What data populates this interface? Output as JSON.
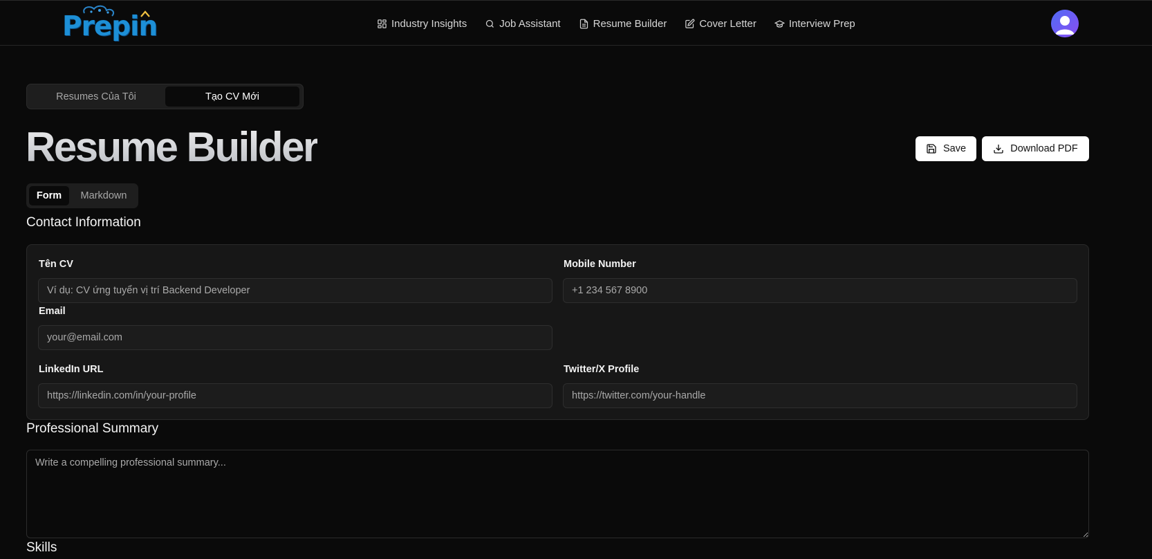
{
  "header": {
    "logo_text": "Prepin",
    "nav": [
      {
        "label": "Industry Insights",
        "icon": "dashboard-icon"
      },
      {
        "label": "Job Assistant",
        "icon": "search-icon"
      },
      {
        "label": "Resume Builder",
        "icon": "document-icon"
      },
      {
        "label": "Cover Letter",
        "icon": "pen-square-icon"
      },
      {
        "label": "Interview Prep",
        "icon": "graduation-cap-icon"
      }
    ],
    "avatar_icon": "user-avatar-icon"
  },
  "top_tabs": {
    "my_resumes": "Resumes Của Tôi",
    "new_cv": "Tạo CV Mới",
    "active": "new_cv"
  },
  "page": {
    "title": "Resume Builder",
    "save_label": "Save",
    "download_label": "Download PDF"
  },
  "mode_tabs": {
    "form": "Form",
    "markdown": "Markdown",
    "active": "form"
  },
  "contact": {
    "section_title": "Contact Information",
    "cv_name": {
      "label": "Tên CV",
      "value": "",
      "placeholder": "Ví dụ: CV ứng tuyển vị trí Backend Developer"
    },
    "mobile": {
      "label": "Mobile Number",
      "value": "",
      "placeholder": "+1 234 567 8900"
    },
    "email": {
      "label": "Email",
      "value": "",
      "placeholder": "your@email.com"
    },
    "linkedin": {
      "label": "LinkedIn URL",
      "value": "",
      "placeholder": "https://linkedin.com/in/your-profile"
    },
    "twitter": {
      "label": "Twitter/X Profile",
      "value": "",
      "placeholder": "https://twitter.com/your-handle"
    }
  },
  "summary": {
    "section_title": "Professional Summary",
    "value": "",
    "placeholder": "Write a compelling professional summary..."
  },
  "skills": {
    "section_title": "Skills"
  },
  "colors": {
    "background": "#0a0a0a",
    "card": "#171717",
    "accent_avatar": "#6a5cf6",
    "logo_blue": "#1d8fd6"
  }
}
